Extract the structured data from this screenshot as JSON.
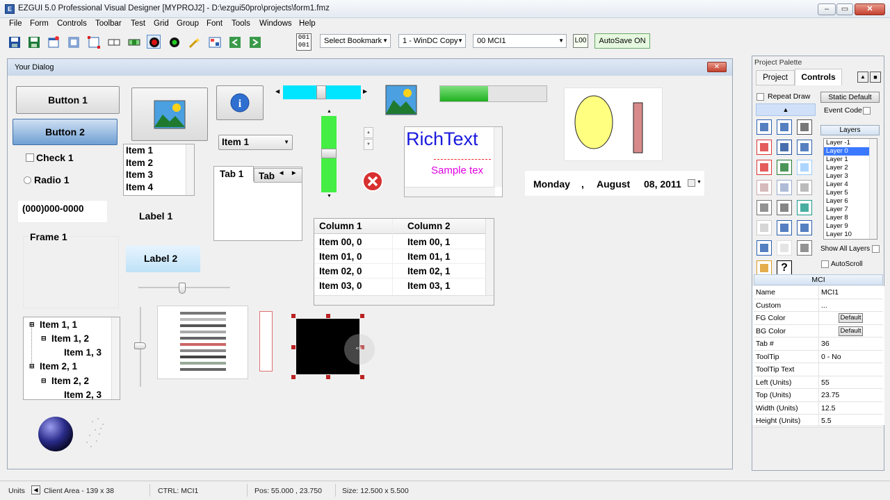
{
  "window": {
    "title": "EZGUI 5.0 Professional Visual Designer   [MYPROJ2] - D:\\ezgui50pro\\projects\\form1.fmz",
    "min": "–",
    "max": "▭",
    "close": "✕"
  },
  "menu": [
    "File",
    "Form",
    "Controls",
    "Toolbar",
    "Test",
    "Grid",
    "Group",
    "Font",
    "Tools",
    "Windows",
    "Help"
  ],
  "toolbar": {
    "counter_top": "001",
    "counter_bottom": "001",
    "bookmark": "Select Bookmark",
    "copy_mode": "1 - WinDC Copy",
    "control_select": "00  MCI1",
    "lock_label": "L00",
    "autosave": "AutoSave ON"
  },
  "dialog": {
    "title": "Your Dialog",
    "button1": "Button  1",
    "button2": "Button  2",
    "check1": "Check  1",
    "radio1": "Radio  1",
    "masked": "(000)000-0000",
    "frame1": "Frame  1",
    "label1": "Label  1",
    "label2": "Label  2",
    "listbox": [
      "Item 1",
      "Item 2",
      "Item 3",
      "Item 4"
    ],
    "combo": "Item 1",
    "tab1": "Tab 1",
    "tab2": "Tab",
    "richtext": "RichText",
    "richtext_sample": "Sample tex",
    "date": {
      "day": "Monday",
      "sep": ",",
      "month": "August",
      "rest": "08, 2011"
    },
    "listview": {
      "headers": [
        "Column 1",
        "Column 2"
      ],
      "rows": [
        [
          "Item 00, 0",
          "Item 00, 1"
        ],
        [
          "Item 01, 0",
          "Item 01, 1"
        ],
        [
          "Item 02, 0",
          "Item 02, 1"
        ],
        [
          "Item 03, 0",
          "Item 03, 1"
        ]
      ]
    },
    "tree": [
      "Item 1, 1",
      "Item 1, 2",
      "Item 1, 3",
      "Item 2, 1",
      "Item 2, 2",
      "Item 2, 3"
    ],
    "progress_percent": 45
  },
  "palette": {
    "title": "Project Palette",
    "tab_project": "Project",
    "tab_controls": "Controls",
    "repeat_draw": "Repeat Draw",
    "static_default": "Static Default",
    "event_code": "Event Code",
    "layers_title": "Layers",
    "layers": [
      "Layer -1",
      "Layer 0",
      "Layer 1",
      "Layer 2",
      "Layer 3",
      "Layer 4",
      "Layer 5",
      "Layer 6",
      "Layer 7",
      "Layer 8",
      "Layer 9",
      "Layer 10"
    ],
    "show_all_layers": "Show All Layers",
    "autoscroll": "AutoScroll",
    "props_title": "MCI",
    "props": [
      {
        "k": "Name",
        "v": "MCI1"
      },
      {
        "k": "Custom",
        "v": "..."
      },
      {
        "k": "FG Color",
        "v": "Default"
      },
      {
        "k": "BG Color",
        "v": "Default"
      },
      {
        "k": "Tab #",
        "v": "36"
      },
      {
        "k": "ToolTip",
        "v": "0 - No"
      },
      {
        "k": "ToolTip Text",
        "v": ""
      },
      {
        "k": "Left (Units)",
        "v": "55"
      },
      {
        "k": "Top (Units)",
        "v": "23.75"
      },
      {
        "k": "Width (Units)",
        "v": "12.5"
      },
      {
        "k": "Height (Units)",
        "v": "5.5"
      }
    ]
  },
  "status": {
    "units": "Units",
    "client_area": "Client Area - 139 x 38",
    "ctrl": "CTRL: MCI1",
    "pos": "Pos: 55.000 ,  23.750",
    "size": "Size: 12.500  x  5.500"
  },
  "colors": {
    "accent": "#3a78c3",
    "progress": "#22c022",
    "cyan": "#00e5ff",
    "green": "#44ee44",
    "ellipse": "#ffff80",
    "richtext": "#1a1adc",
    "sample": "#e000e0"
  }
}
